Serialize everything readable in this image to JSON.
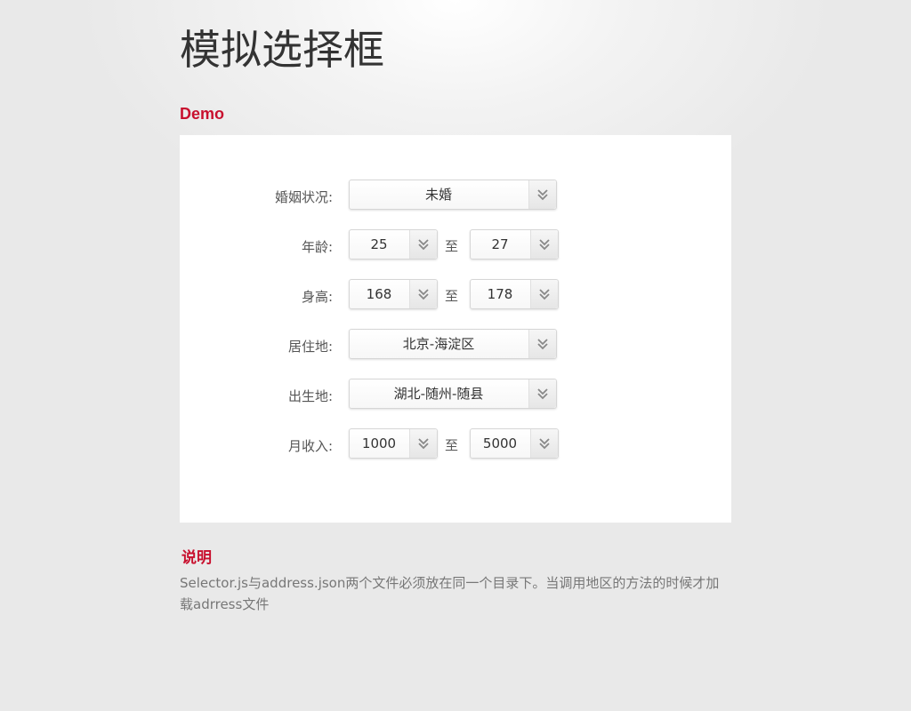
{
  "page": {
    "title": "模拟选择框",
    "demo_heading": "Demo",
    "notes_heading": "说明",
    "notes_text": "Selector.js与address.json两个文件必须放在同一个目录下。当调用地区的方法的时候才加载adrress文件"
  },
  "form": {
    "to_label": "至",
    "marital": {
      "label": "婚姻状况:",
      "value": "未婚"
    },
    "age": {
      "label": "年龄:",
      "from": "25",
      "to": "27"
    },
    "height": {
      "label": "身高:",
      "from": "168",
      "to": "178"
    },
    "residence": {
      "label": "居住地:",
      "value": "北京-海淀区"
    },
    "birthplace": {
      "label": "出生地:",
      "value": "湖北-随州-随县"
    },
    "income": {
      "label": "月收入:",
      "from": "1000",
      "to": "5000"
    }
  },
  "icons": {
    "select_arrow": "double-chevron-down-icon"
  },
  "colors": {
    "accent": "#c8102e",
    "panel": "#ffffff",
    "background": "#e9e9e9"
  }
}
